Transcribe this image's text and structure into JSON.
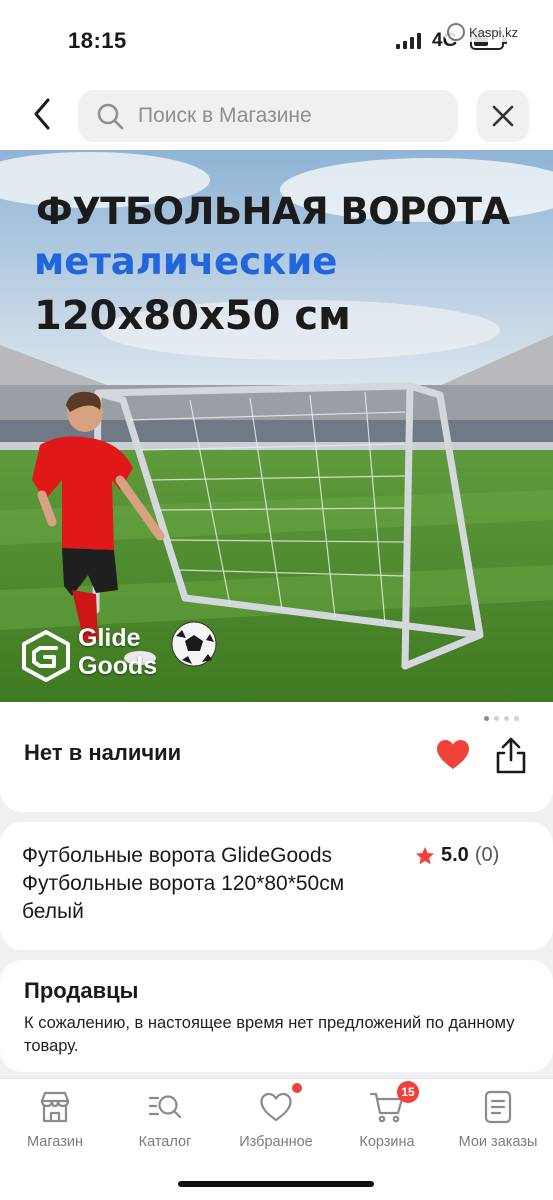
{
  "status_bar": {
    "time": "18:15",
    "network": "4G",
    "battery_level": 0.55,
    "return_app": "Kaspi.kz"
  },
  "header": {
    "search_placeholder": "Поиск в Магазине",
    "back_icon": "chevron-left-icon",
    "close_icon": "close-icon"
  },
  "product_image": {
    "headline": "ФУТБОЛЬНАЯ ВОРОТА",
    "subheadline": "металические",
    "dimensions": "120x80x50 см",
    "brand_line1": "Glide",
    "brand_line2": "Goods",
    "carousel_total": 4,
    "carousel_active": 1
  },
  "availability": {
    "status": "Нет в наличии",
    "favorite_icon": "heart-filled-icon",
    "share_icon": "share-icon"
  },
  "product": {
    "title": "Футбольные ворота GlideGoods Футбольные ворота 120*80*50см белый",
    "rating": "5.0",
    "reviews": "(0)"
  },
  "sellers": {
    "heading": "Продавцы",
    "message": "К сожалению, в настоящее время нет предложений по данному товару."
  },
  "bottom_nav": {
    "items": [
      {
        "label": "Магазин",
        "icon": "shop-icon"
      },
      {
        "label": "Каталог",
        "icon": "catalog-search-icon"
      },
      {
        "label": "Избранное",
        "icon": "heart-outline-icon",
        "dot": true
      },
      {
        "label": "Корзина",
        "icon": "cart-icon",
        "badge": "15"
      },
      {
        "label": "Мои заказы",
        "icon": "orders-icon"
      }
    ]
  },
  "colors": {
    "accent_red": "#f1423a",
    "headline_blue": "#2266dd",
    "background": "#f0f0f3"
  }
}
